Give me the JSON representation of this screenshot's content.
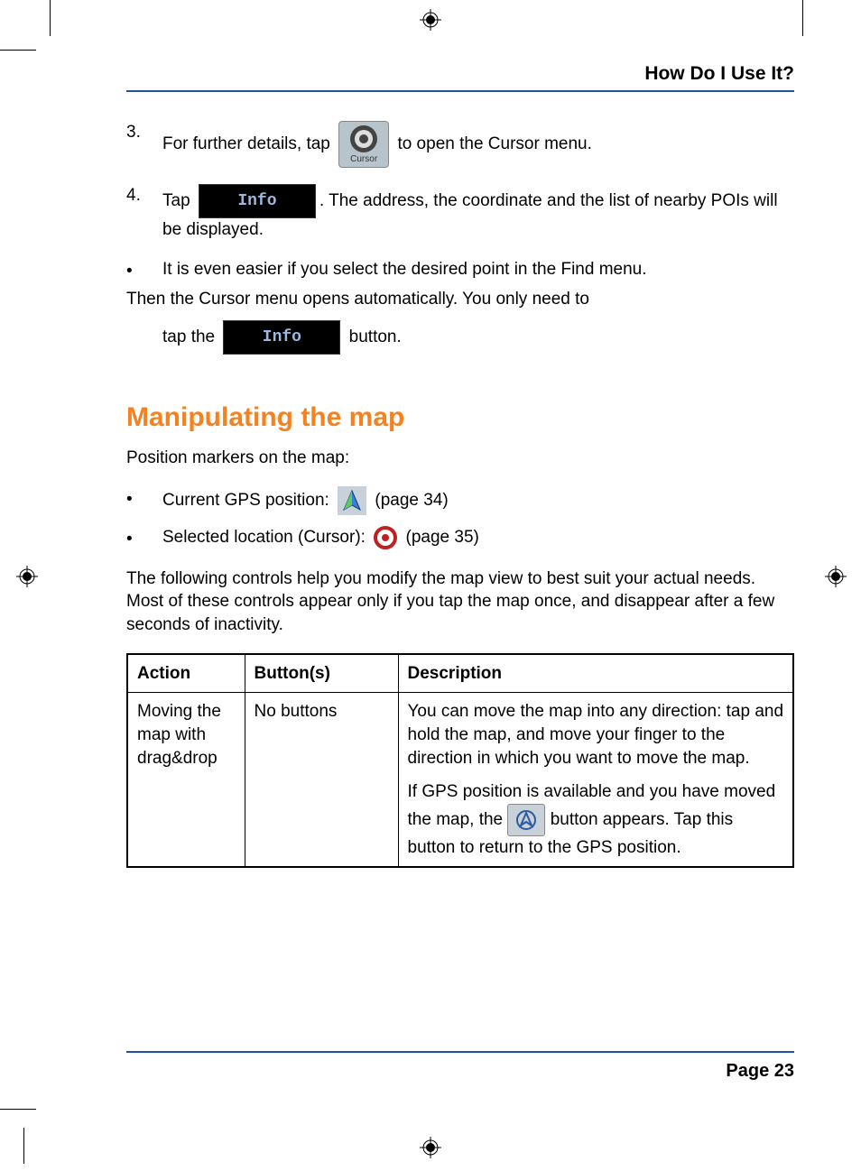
{
  "header": {
    "title": "How Do I Use It?"
  },
  "steps": {
    "s3": {
      "num": "3.",
      "before": "For further details, tap ",
      "after": " to open the Cursor menu.",
      "icon_label": "Cursor"
    },
    "s4": {
      "num": "4.",
      "before": "Tap ",
      "after": ". The address, the coordinate and the list of nearby POIs will be displayed.",
      "btn_label": "Info"
    }
  },
  "bullet1": {
    "line1": "It is even easier if you select the desired point in the Find menu.",
    "line2a": "Then the Cursor menu opens automatically. You only need to",
    "line2b_before": "tap the ",
    "line2b_after": " button.",
    "btn_label": "Info"
  },
  "section_heading": "Manipulating the map",
  "intro": "Position markers on the map:",
  "markers": {
    "gps": {
      "before": "Current GPS position: ",
      "after": " (page 34)"
    },
    "cursor": {
      "before": "Selected location (Cursor): ",
      "after": " (page 35)"
    }
  },
  "para2": "The following controls help you modify the map view to best suit your actual needs. Most of these controls appear only if you tap the map once, and disappear after a few seconds of inactivity.",
  "table": {
    "headers": {
      "action": "Action",
      "buttons": "Button(s)",
      "desc": "Description"
    },
    "row1": {
      "action": "Moving the map with drag&drop",
      "buttons": "No buttons",
      "desc1": "You can move the map into any direction: tap and hold the map, and move your finger to the direction in which you want to move the map.",
      "desc2a": "If GPS position is available and you have moved the map, the ",
      "desc2b": " button appears. Tap this button to return to the GPS position."
    }
  },
  "footer": {
    "page": "Page 23"
  }
}
